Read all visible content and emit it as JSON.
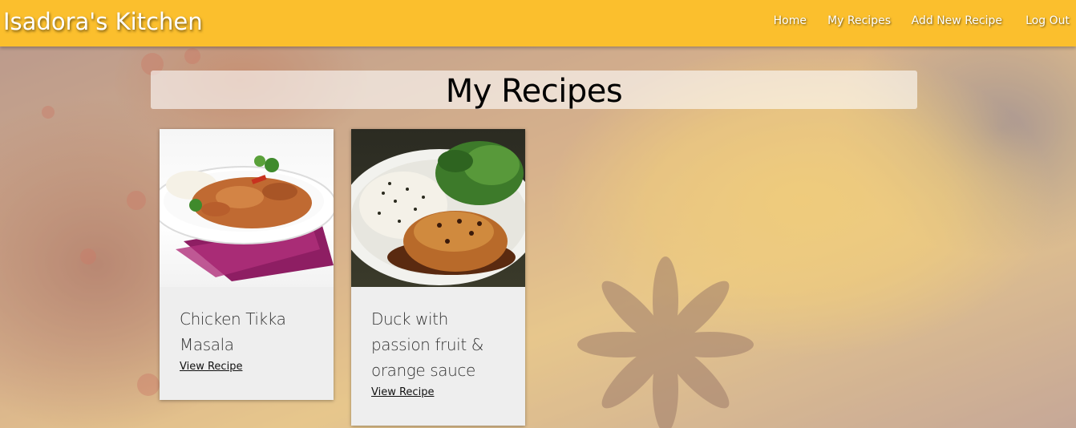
{
  "navbar": {
    "brand": "Isadora's Kitchen",
    "links": [
      "Home",
      "My Recipes",
      "Add New Recipe",
      "Log Out"
    ]
  },
  "page": {
    "title": "My Recipes"
  },
  "recipes": [
    {
      "name": "Chicken Tikka Masala",
      "link_label": "View Recipe",
      "image": "chicken-tikka-masala-photo"
    },
    {
      "name": "Duck with passion fruit & orange sauce",
      "link_label": "View Recipe",
      "image": "duck-passion-fruit-photo"
    }
  ],
  "colors": {
    "navbar": "#fbbf2d",
    "card": "#eeeeee",
    "nav_text": "#ffffff"
  }
}
